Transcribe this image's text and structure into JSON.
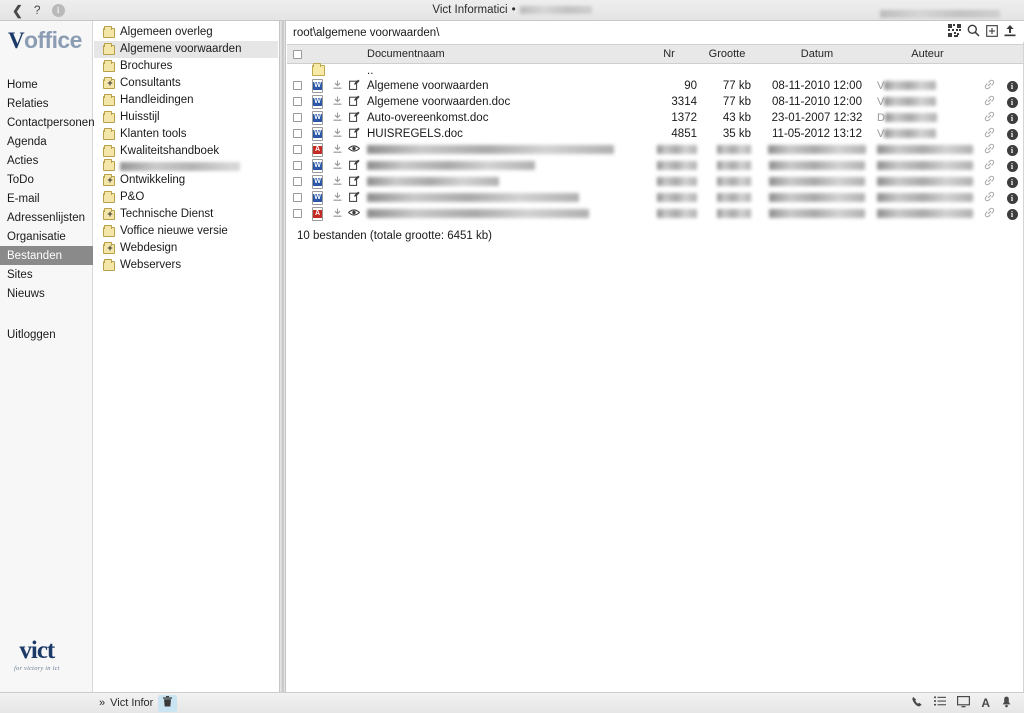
{
  "titlebar": {
    "back_icon": "chevron-left-icon",
    "help_label": "?",
    "info_label": "i",
    "title": "Vict Informatici",
    "title_separator": "•",
    "redacted_title_width": 72,
    "redacted_right_width": 120
  },
  "sidebar": {
    "logo_v": "V",
    "logo_rest": "office",
    "items": [
      {
        "label": "Home",
        "selected": false
      },
      {
        "label": "Relaties",
        "selected": false
      },
      {
        "label": "Contactpersonen",
        "selected": false
      },
      {
        "label": "Agenda",
        "selected": false
      },
      {
        "label": "Acties",
        "selected": false
      },
      {
        "label": "ToDo",
        "selected": false
      },
      {
        "label": "E-mail",
        "selected": false
      },
      {
        "label": "Adressenlijsten",
        "selected": false
      },
      {
        "label": "Organisatie",
        "selected": false
      },
      {
        "label": "Bestanden",
        "selected": true
      },
      {
        "label": "Sites",
        "selected": false
      },
      {
        "label": "Nieuws",
        "selected": false
      }
    ],
    "logout_label": "Uitloggen",
    "footer_logo_word": "vict",
    "footer_logo_tagline": "for victory in ict"
  },
  "tree": {
    "items": [
      {
        "label": "Algemeen overleg",
        "expandable": false,
        "selected": false,
        "redacted": false
      },
      {
        "label": "Algemene voorwaarden",
        "expandable": false,
        "selected": true,
        "redacted": false
      },
      {
        "label": "Brochures",
        "expandable": false,
        "selected": false,
        "redacted": false
      },
      {
        "label": "Consultants",
        "expandable": true,
        "selected": false,
        "redacted": false
      },
      {
        "label": "Handleidingen",
        "expandable": false,
        "selected": false,
        "redacted": false
      },
      {
        "label": "Huisstijl",
        "expandable": false,
        "selected": false,
        "redacted": false
      },
      {
        "label": "Klanten tools",
        "expandable": false,
        "selected": false,
        "redacted": false
      },
      {
        "label": "Kwaliteitshandboek",
        "expandable": false,
        "selected": false,
        "redacted": false
      },
      {
        "label": "",
        "expandable": false,
        "selected": false,
        "redacted": true
      },
      {
        "label": "Ontwikkeling",
        "expandable": true,
        "selected": false,
        "redacted": false
      },
      {
        "label": "P&O",
        "expandable": false,
        "selected": false,
        "redacted": false
      },
      {
        "label": "Technische Dienst",
        "expandable": true,
        "selected": false,
        "redacted": false
      },
      {
        "label": "Voffice nieuwe versie",
        "expandable": false,
        "selected": false,
        "redacted": false
      },
      {
        "label": "Webdesign",
        "expandable": true,
        "selected": false,
        "redacted": false
      },
      {
        "label": "Webservers",
        "expandable": false,
        "selected": false,
        "redacted": false
      }
    ]
  },
  "filepane": {
    "breadcrumb": "root\\algemene voorwaarden\\",
    "toolbar": [
      {
        "name": "grid-view-icon",
        "glyph": "▦"
      },
      {
        "name": "search-icon",
        "glyph": "🔍"
      },
      {
        "name": "new-folder-icon",
        "glyph": "⊞"
      },
      {
        "name": "upload-icon",
        "glyph": "⬆"
      }
    ],
    "columns": [
      "",
      "",
      "",
      "",
      "Documentnaam",
      "Nr",
      "Grootte",
      "Datum",
      "Auteur",
      "",
      ""
    ],
    "parent_row_label": "..",
    "rows": [
      {
        "type": "word",
        "action": "edit",
        "name": "Algemene voorwaarden",
        "nr": "90",
        "size": "77 kb",
        "date": "08-11-2010 12:00",
        "author": "V",
        "author_redacted": true,
        "name_redacted": false
      },
      {
        "type": "word",
        "action": "edit",
        "name": "Algemene voorwaarden.doc",
        "nr": "3314",
        "size": "77 kb",
        "date": "08-11-2010 12:00",
        "author": "V",
        "author_redacted": true,
        "name_redacted": false
      },
      {
        "type": "word",
        "action": "edit",
        "name": "Auto-overeenkomst.doc",
        "nr": "1372",
        "size": "43 kb",
        "date": "23-01-2007 12:32",
        "author": "D",
        "author_redacted": true,
        "name_redacted": false
      },
      {
        "type": "word",
        "action": "edit",
        "name": "HUISREGELS.doc",
        "nr": "4851",
        "size": "35 kb",
        "date": "11-05-2012 13:12",
        "author": "V",
        "author_redacted": true,
        "name_redacted": false
      },
      {
        "type": "pdf",
        "action": "view",
        "name": "",
        "nr": "",
        "size": "",
        "date": "",
        "author": "",
        "author_redacted": true,
        "name_redacted": true,
        "name_width": 247,
        "nr_width": 40,
        "date_width": 98
      },
      {
        "type": "word",
        "action": "edit",
        "name": "",
        "nr": "",
        "size": "",
        "date": "",
        "author": "",
        "author_redacted": true,
        "name_redacted": true,
        "name_width": 168,
        "nr_width": 40,
        "date_width": 96
      },
      {
        "type": "word",
        "action": "edit",
        "name": "",
        "nr": "",
        "size": "",
        "date": "",
        "author": "",
        "author_redacted": true,
        "name_redacted": true,
        "name_width": 132,
        "nr_width": 40,
        "date_width": 96
      },
      {
        "type": "word",
        "action": "edit",
        "name": "",
        "nr": "",
        "size": "",
        "date": "",
        "author": "",
        "author_redacted": true,
        "name_redacted": true,
        "name_width": 212,
        "nr_width": 40,
        "date_width": 96
      },
      {
        "type": "pdf",
        "action": "view",
        "name": "",
        "nr": "",
        "size": "",
        "date": "",
        "author": "",
        "author_redacted": true,
        "name_redacted": true,
        "name_width": 222,
        "nr_width": 40,
        "date_width": 96
      }
    ],
    "hidden_row_count": 1,
    "summary": "10 bestanden (totale grootte: 6451 kb)",
    "word_badge": "W",
    "pdf_badge": "A",
    "download_glyph": "⇩",
    "edit_glyph": "✎",
    "view_glyph": "👁",
    "link_glyph": "🔗",
    "info_glyph": "i"
  },
  "statusbar": {
    "prefix": "»",
    "label": "Vict Infor",
    "trash_icon": "trash-icon",
    "trash_glyph": "🗑",
    "right_icons": [
      {
        "name": "phone-icon",
        "glyph": "✆"
      },
      {
        "name": "list-icon",
        "glyph": "☰"
      },
      {
        "name": "monitor-icon",
        "glyph": "🖵"
      },
      {
        "name": "text-icon",
        "glyph": "A"
      },
      {
        "name": "bell-icon",
        "glyph": "🔔"
      }
    ]
  },
  "colors": {
    "accent": "#1b3a68",
    "selection": "#8a8a8a",
    "tree_selection": "#e6e6e6",
    "header_bg": "#e8e8e8",
    "word_blue": "#2b57a8",
    "pdf_red": "#c32a22",
    "folder_yellow": "#f3e6a8",
    "trash_highlight": "#cbe4f2"
  }
}
